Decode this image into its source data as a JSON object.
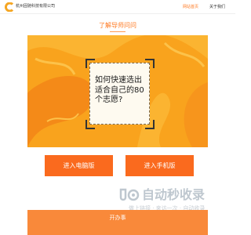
{
  "header": {
    "company_name": "杭州固驰科技有限公司",
    "logo_icon": "brand-c-logo-icon",
    "nav": [
      {
        "label": "网站首页",
        "active": true
      },
      {
        "label": "关于我们",
        "active": false
      }
    ]
  },
  "section": {
    "title": "了解导师问问"
  },
  "hero": {
    "question": "如何快速选出适合自己的80个志愿?"
  },
  "buttons": {
    "pc_label": "进入电脑版",
    "mobile_label": "进入手机版"
  },
  "watermark": {
    "badge_icon": "tool-badge-icon",
    "main_text": "自动秒收录",
    "sub_text": "做上链接 · 来访一次 · 自动收录"
  },
  "bottom": {
    "title": "开办事"
  },
  "colors": {
    "accent": "#ff7a22",
    "button": "#fa6a1e",
    "hero_background": "#f9a31d"
  }
}
